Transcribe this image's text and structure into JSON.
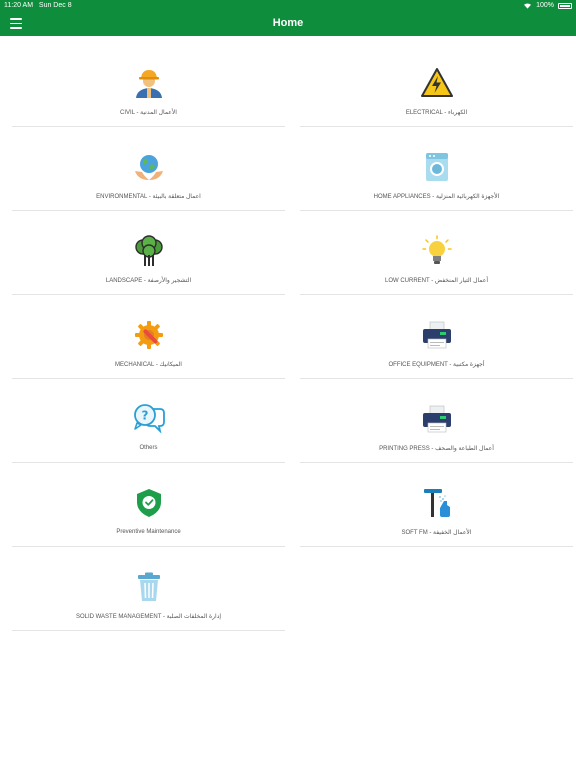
{
  "status": {
    "time": "11:20 AM",
    "date": "Sun Dec 8",
    "battery": "100%"
  },
  "header": {
    "title": "Home"
  },
  "tiles": [
    {
      "label": "CIVIL - الأعمال المدنية",
      "icon": "worker-icon"
    },
    {
      "label": "ELECTRICAL - الكهرباء",
      "icon": "lightning-icon"
    },
    {
      "label": "ENVIRONMENTAL - اعمال متعلقة بالبيئة",
      "icon": "earth-hands-icon"
    },
    {
      "label": "HOME APPLIANCES - الأجهزة الكهربائية المنزلية",
      "icon": "washing-machine-icon"
    },
    {
      "label": "LANDSCAPE - التشجير والأرصفة",
      "icon": "tree-icon"
    },
    {
      "label": "LOW CURRENT - أعمال التيار المنخفض",
      "icon": "light-bulb-icon"
    },
    {
      "label": "MECHANICAL - الميكانيك",
      "icon": "gear-wrench-icon"
    },
    {
      "label": "OFFICE EQUIPMENT - أجهزة مكتبية",
      "icon": "printer-icon"
    },
    {
      "label": "Others",
      "icon": "question-chat-icon"
    },
    {
      "label": "PRINTING PRESS - أعمال الطباعة والصحف",
      "icon": "printer-icon"
    },
    {
      "label": "Preventive Maintenance",
      "icon": "shield-check-icon"
    },
    {
      "label": "SOFT FM - الأعمال الخفيفة",
      "icon": "cleaning-icon"
    },
    {
      "label": "SOLID WASTE MANAGEMENT - إدارة المخلفات الصلبة",
      "icon": "trash-bin-icon"
    }
  ],
  "colors": {
    "header": "#0e8e3c",
    "divider": "#e4e4e4",
    "label": "#555555"
  }
}
